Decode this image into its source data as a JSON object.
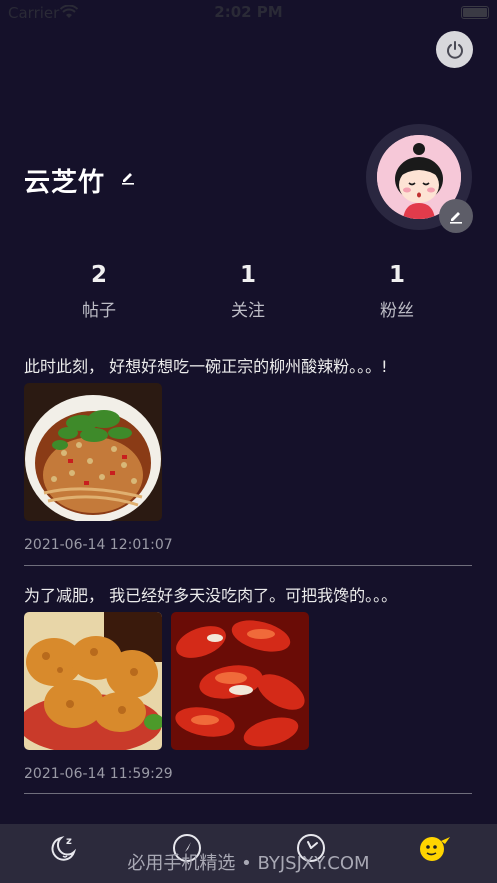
{
  "status_bar": {
    "carrier": "Carrier",
    "time": "2:02 PM"
  },
  "profile": {
    "username": "云芝竹"
  },
  "stats": [
    {
      "value": "2",
      "label": "帖子"
    },
    {
      "value": "1",
      "label": "关注"
    },
    {
      "value": "1",
      "label": "粉丝"
    }
  ],
  "posts": [
    {
      "text": "此时此刻， 好想好想吃一碗正宗的柳州酸辣粉。。。!",
      "time": "2021-06-14 12:01:07"
    },
    {
      "text": "为了减肥， 我已经好多天没吃肉了。可把我馋的。。。",
      "time": "2021-06-14 11:59:29"
    }
  ],
  "watermark": "必用手机精选 • BYJSJXY.COM",
  "icons": {
    "power": "power-icon",
    "edit": "pencil-icon",
    "tab_1": "moon-sleep-icon",
    "tab_2": "compass-icon",
    "tab_3": "clock-icon",
    "tab_4": "emoji-face-icon"
  },
  "colors": {
    "background": "#15112a",
    "tabbar": "#2c2a3c",
    "accent": "#ffd400"
  }
}
